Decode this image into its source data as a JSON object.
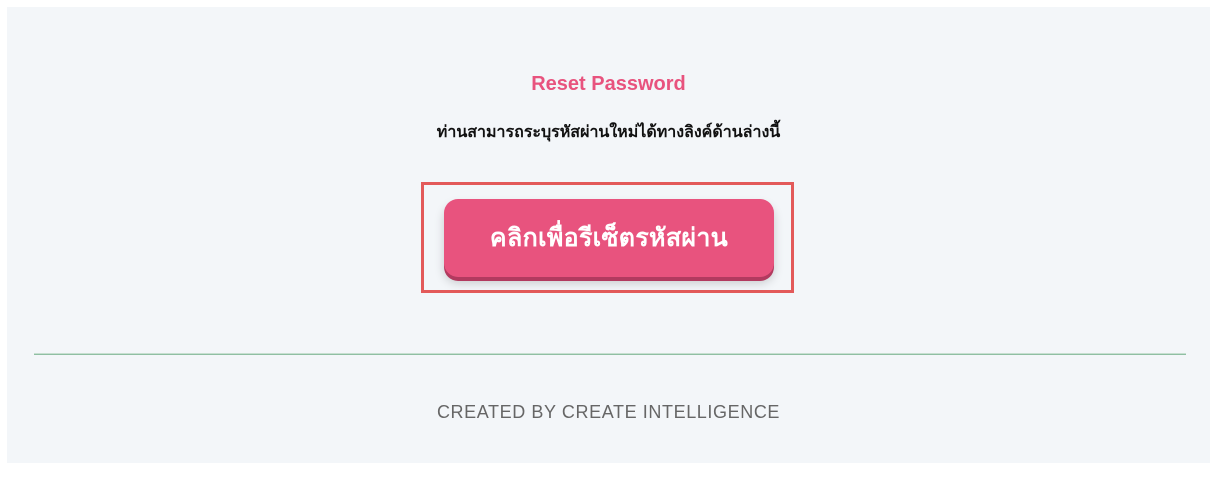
{
  "email": {
    "title": "Reset Password",
    "message": "ท่านสามารถระบุรหัสผ่านใหม่ได้ทางลิงค์ด้านล่างนี้",
    "button_label": "คลิกเพื่อรีเซ็ตรหัสผ่าน",
    "footer": "CREATED BY CREATE INTELLIGENCE"
  },
  "colors": {
    "accent": "#e8537e",
    "highlight_border": "#e35a5a",
    "panel_background": "#f3f6f9",
    "divider": "#8fbfa3"
  }
}
